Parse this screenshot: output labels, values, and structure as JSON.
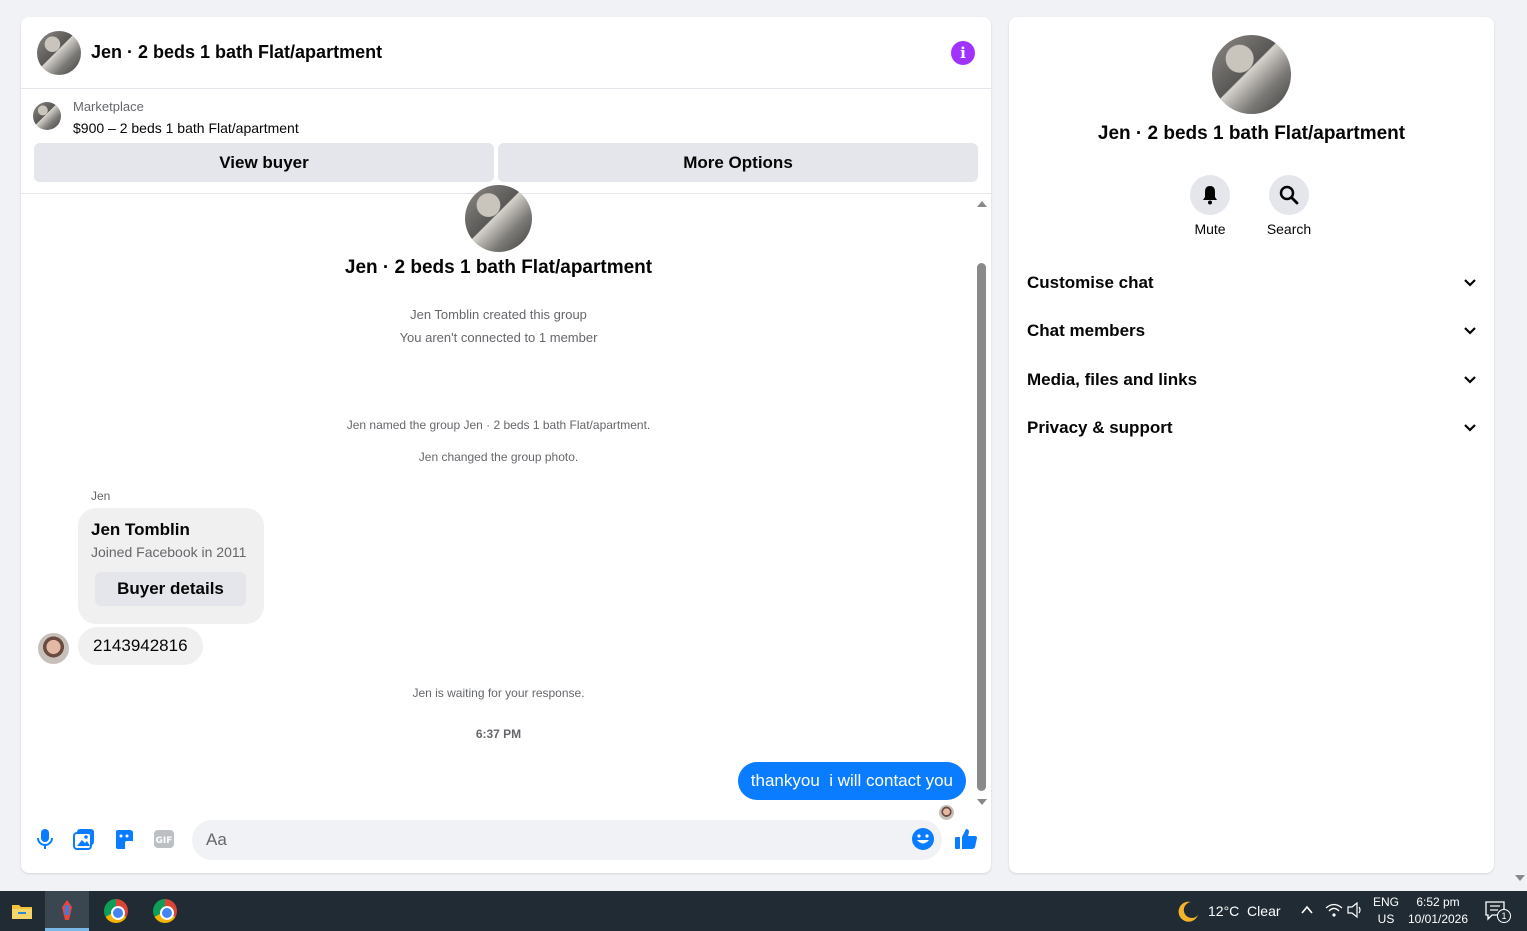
{
  "chat": {
    "title": "Jen · 2 beds 1 bath Flat/apartment",
    "info_icon": "info-icon",
    "marketplace": {
      "label": "Marketplace",
      "listing": "$900 – 2 beds 1 bath Flat/apartment",
      "view_buyer": "View buyer",
      "more_options": "More Options"
    },
    "thread": {
      "group_name": "Jen · 2 beds 1 bath Flat/apartment",
      "created": "Jen Tomblin created this group",
      "connection": "You aren't connected to 1 member",
      "renamed": "Jen named the group Jen · 2 beds 1 bath Flat/apartment.",
      "photo_changed": "Jen changed the group photo.",
      "sender": "Jen",
      "buyer_card": {
        "name": "Jen Tomblin",
        "joined": "Joined Facebook in 2011",
        "button": "Buyer details"
      },
      "incoming_message": "2143942816",
      "waiting": "Jen is waiting for your response.",
      "timestamp": "6:37 PM",
      "outgoing_message": "thankyou  i will contact you"
    },
    "composer": {
      "placeholder": "Aa",
      "tools": [
        "microphone-icon",
        "image-icon",
        "sticker-icon",
        "gif-icon",
        "emoji-icon",
        "thumbs-up-icon"
      ]
    }
  },
  "side_panel": {
    "title": "Jen · 2 beds 1 bath Flat/apartment",
    "actions": [
      {
        "label": "Mute",
        "icon": "bell-icon"
      },
      {
        "label": "Search",
        "icon": "search-icon"
      }
    ],
    "sections": [
      {
        "label": "Customise chat"
      },
      {
        "label": "Chat members"
      },
      {
        "label": "Media, files and links"
      },
      {
        "label": "Privacy & support"
      }
    ]
  },
  "taskbar": {
    "weather": "12°C  Clear",
    "language": "ENG",
    "region": "US",
    "time": "6:52 pm",
    "date": "10/01/2026",
    "notifications": "1"
  },
  "colors": {
    "accent_blue": "#0a7cff",
    "info_purple": "#a033ff",
    "bubble_gray": "#f0f0f0",
    "taskbar": "#202b33"
  }
}
